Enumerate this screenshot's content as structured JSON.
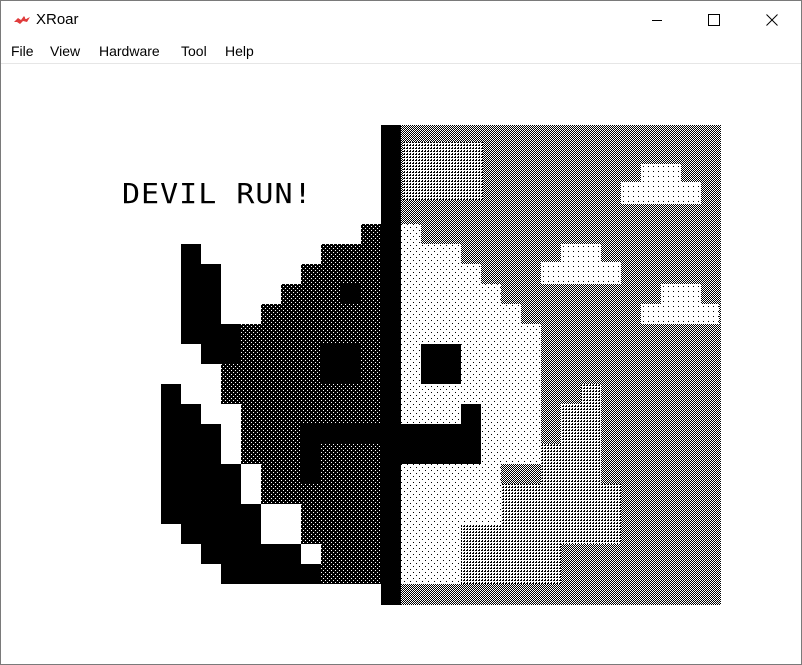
{
  "window": {
    "title": "XRoar",
    "app_icon": "xroar-dragon-icon",
    "controls": {
      "minimize_icon": "minimize-icon",
      "maximize_icon": "maximize-icon",
      "close_icon": "close-icon"
    }
  },
  "menu": {
    "items": [
      "File",
      "View",
      "Hardware",
      "Tool",
      "Help"
    ]
  },
  "game": {
    "title_text": "DEVIL RUN!"
  },
  "colors": {
    "ink": "#000000",
    "paper": "#ffffff",
    "icon_accent": "#e03c3c"
  }
}
